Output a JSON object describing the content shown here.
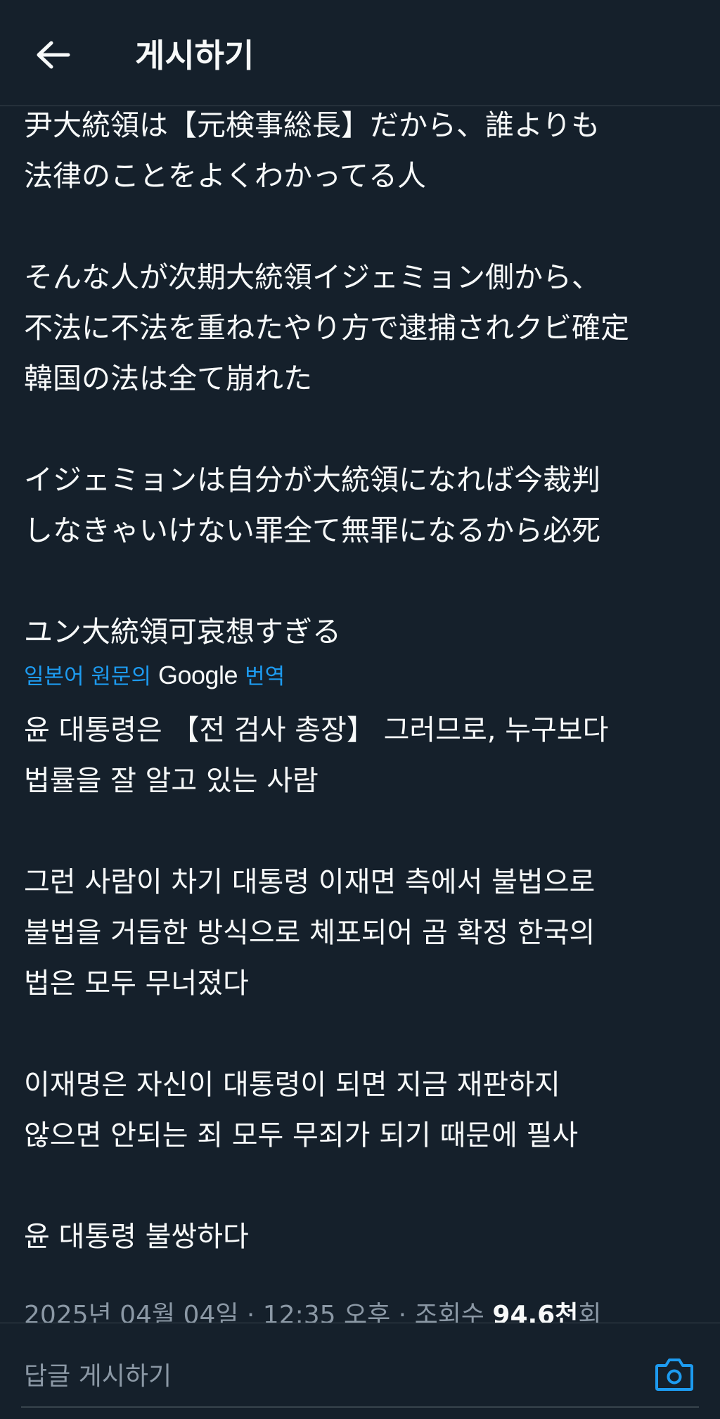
{
  "header": {
    "title": "게시하기",
    "back_icon": "arrow-left-icon"
  },
  "post": {
    "original_lines": [
      "尹大統領は【元検事総長】だから、誰よりも",
      "法律のことをよくわかってる人",
      "",
      "そんな人が次期大統領イジェミョン側から、",
      "不法に不法を重ねたやり方で逮捕されクビ確定",
      "韓国の法は全て崩れた",
      "",
      "イジェミョンは自分が大統領になれば今裁判",
      "しなきゃいけない罪全て無罪になるから必死",
      "",
      "ユン大統領可哀想すぎる"
    ],
    "translation_label_before": "일본어 원문의",
    "translation_label_google": "Google",
    "translation_label_after": "번역",
    "translated_lines": [
      "윤 대통령은 【전 검사 총장】 그러므로, 누구보다",
      "법률을 잘 알고 있는 사람",
      "",
      "그런 사람이 차기 대통령 이재면 측에서 불법으로",
      "불법을 거듭한 방식으로 체포되어 곰 확정 한국의",
      "법은 모두 무너졌다",
      "",
      "이재명은 자신이 대통령이 되면 지금 재판하지",
      "않으면 안되는 죄 모두 무죄가 되기 때문에 필사",
      "",
      "윤 대통령 불쌍하다"
    ],
    "meta_text": "2025년 04월 04일 · 12:35 오후 · 조회수",
    "views": "94.6천",
    "views_suffix": "회"
  },
  "reply": {
    "placeholder": "답글 게시하기",
    "camera_icon": "camera-icon"
  },
  "colors": {
    "background": "#15202b",
    "text": "#f7f9f9",
    "secondary": "#8b98a5",
    "accent": "#1d9bf0",
    "divider": "#38444d"
  }
}
